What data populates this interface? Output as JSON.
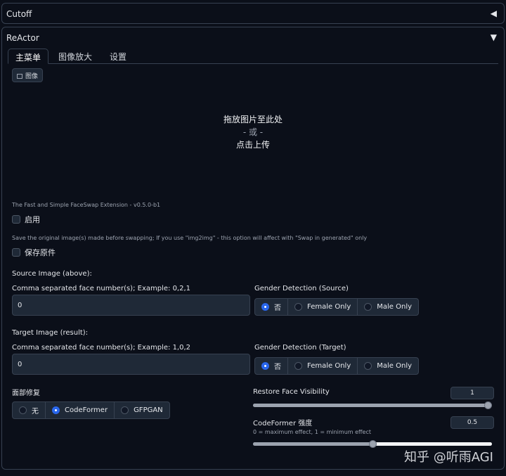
{
  "cutoff": {
    "title": "Cutoff",
    "arrow": "◀"
  },
  "reactor": {
    "title": "ReActor",
    "arrow": "▼",
    "tabs": [
      "主菜单",
      "图像放大",
      "设置"
    ],
    "image_label": "图像",
    "drop": {
      "line1": "拖放图片至此处",
      "or": "- 或 -",
      "line2": "点击上传"
    },
    "version_text": "The Fast and Simple FaceSwap Extension - v0.5.0-b1",
    "enable_label": "启用",
    "save_hint": "Save the original image(s) made before swapping; If you use \"img2img\" - this option will affect with \"Swap in generated\" only",
    "save_label": "保存原件",
    "source_heading": "Source Image (above):",
    "source_faces_label": "Comma separated face number(s); Example: 0,2,1",
    "source_faces_value": "0",
    "gender_source_label": "Gender Detection (Source)",
    "target_heading": "Target Image (result):",
    "target_faces_label": "Comma separated face number(s); Example: 1,0,2",
    "target_faces_value": "0",
    "gender_target_label": "Gender Detection (Target)",
    "gender_options": [
      "否",
      "Female Only",
      "Male Only"
    ],
    "gender_source_selected": "否",
    "gender_target_selected": "否",
    "restore_label": "面部修复",
    "restore_options": [
      "无",
      "CodeFormer",
      "GFPGAN"
    ],
    "restore_selected": "CodeFormer",
    "visibility_label": "Restore Face Visibility",
    "visibility_value": "1",
    "visibility_fraction": 1.0,
    "codeformer_label": "CodeFormer 强度",
    "codeformer_hint": "0 = maximum effect, 1 = minimum effect",
    "codeformer_value": "0.5",
    "codeformer_fraction": 0.5
  },
  "watermark": "知乎 @听雨AGI",
  "colors": {
    "accent": "#2563eb",
    "bg": "#0b0f19",
    "panel_border": "#374151"
  }
}
